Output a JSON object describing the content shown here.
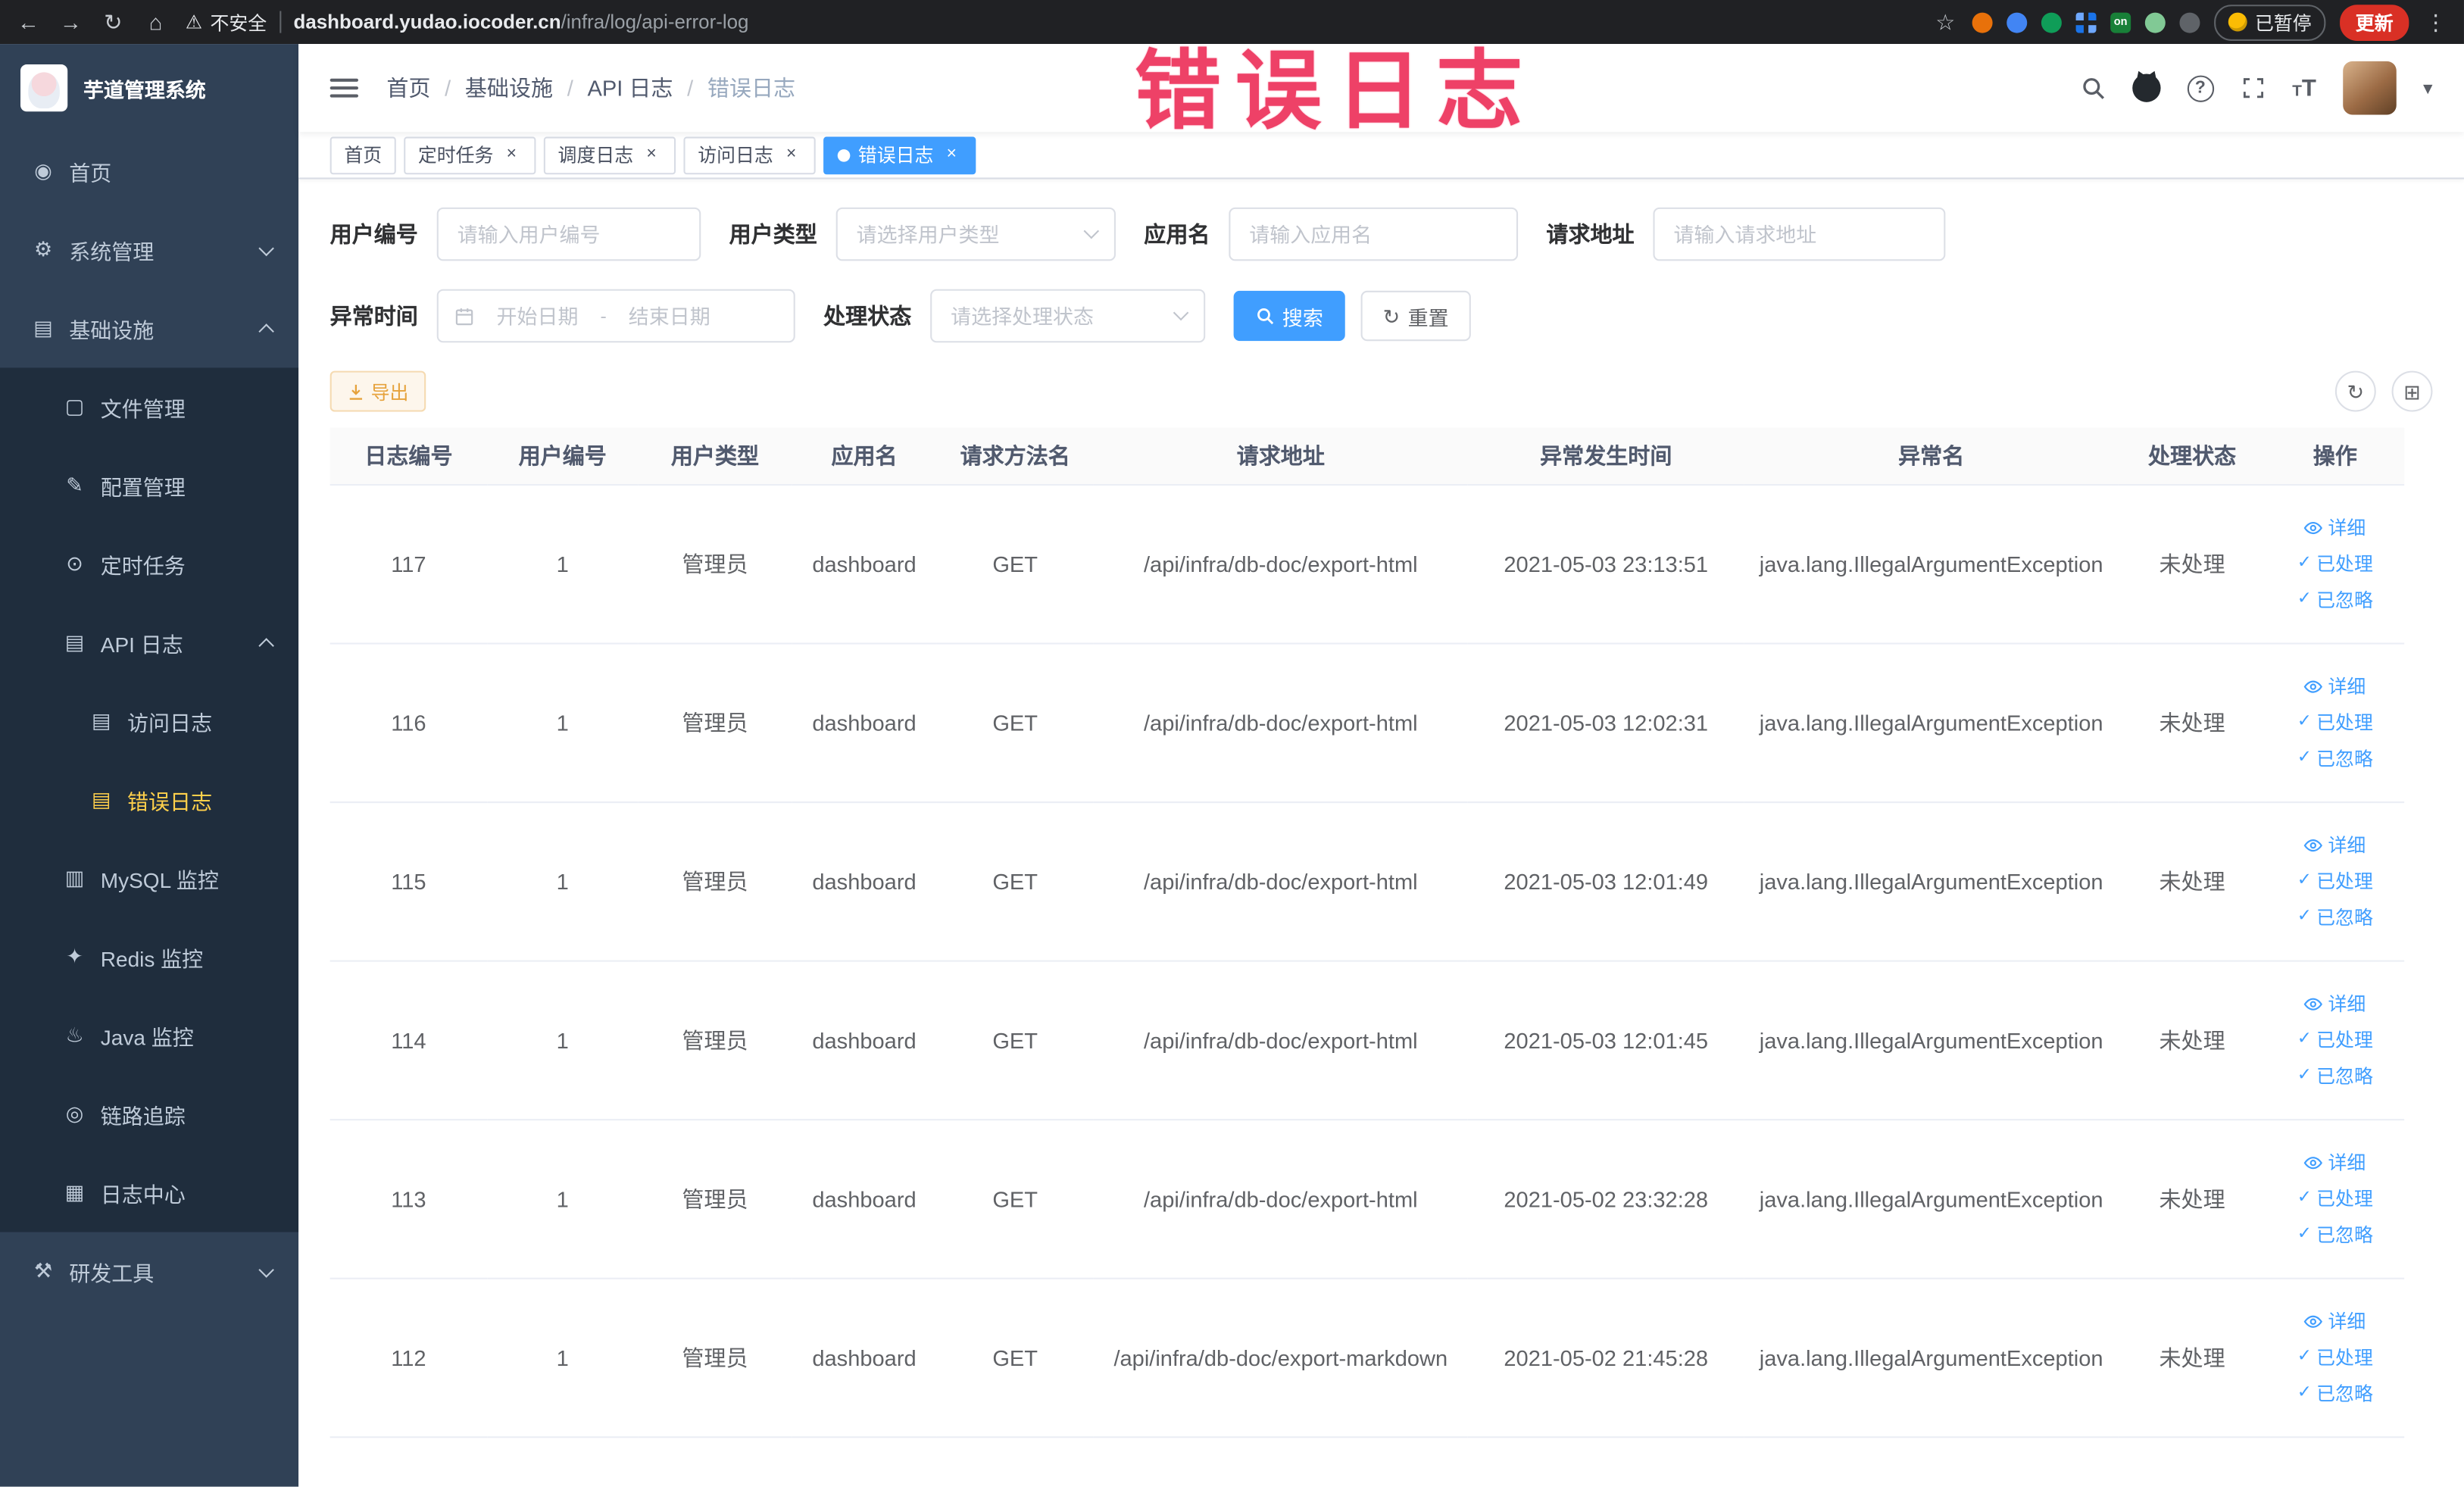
{
  "browser": {
    "security_label": "不安全",
    "url_host": "dashboard.yudao.iocoder.cn",
    "url_path": "/infra/log/api-error-log",
    "ext_on_label": "on",
    "paused_badge": "已暂停",
    "update_button": "更新"
  },
  "icons": {
    "back": "←",
    "forward": "→",
    "reload": "↻",
    "home": "⌂",
    "warning": "⚠",
    "star": "☆",
    "kebab": "⋮",
    "check": "✓",
    "caret_down": "▾",
    "sidebar_home": "◉",
    "sidebar_system": "⚙",
    "sidebar_infra": "▤",
    "sidebar_file": "▢",
    "sidebar_config": "✎",
    "sidebar_job": "⊙",
    "sidebar_api_log": "▤",
    "sidebar_access_log": "▤",
    "sidebar_error_log": "▤",
    "sidebar_mysql": "▥",
    "sidebar_redis": "✦",
    "sidebar_java": "♨",
    "sidebar_trace": "◎",
    "sidebar_log_center": "▦",
    "sidebar_dev_tools": "⚒",
    "refresh": "↻",
    "columns": "⊞"
  },
  "overlay": {
    "label": "错误日志"
  },
  "sidebar": {
    "app_title": "芋道管理系统",
    "items": {
      "home": "首页",
      "system": "系统管理",
      "infra": "基础设施",
      "file": "文件管理",
      "config": "配置管理",
      "job": "定时任务",
      "api_log": "API 日志",
      "access_log": "访问日志",
      "error_log": "错误日志",
      "mysql": "MySQL 监控",
      "redis": "Redis 监控",
      "java": "Java 监控",
      "trace": "链路追踪",
      "log_center": "日志中心",
      "dev_tools": "研发工具"
    }
  },
  "header": {
    "breadcrumb": [
      "首页",
      "基础设施",
      "API 日志",
      "错误日志"
    ]
  },
  "tabs": [
    {
      "label": "首页",
      "closable": false,
      "active": false
    },
    {
      "label": "定时任务",
      "closable": true,
      "active": false
    },
    {
      "label": "调度日志",
      "closable": true,
      "active": false
    },
    {
      "label": "访问日志",
      "closable": true,
      "active": false
    },
    {
      "label": "错误日志",
      "closable": true,
      "active": true
    }
  ],
  "filters": {
    "user_id": {
      "label": "用户编号",
      "placeholder": "请输入用户编号"
    },
    "user_type": {
      "label": "用户类型",
      "placeholder": "请选择用户类型"
    },
    "app_name": {
      "label": "应用名",
      "placeholder": "请输入应用名"
    },
    "request_url": {
      "label": "请求地址",
      "placeholder": "请输入请求地址"
    },
    "exception_time": {
      "label": "异常时间",
      "start_placeholder": "开始日期",
      "separator": "-",
      "end_placeholder": "结束日期"
    },
    "process_status": {
      "label": "处理状态",
      "placeholder": "请选择处理状态"
    },
    "search_button": "搜索",
    "reset_button": "重置"
  },
  "toolbar": {
    "export_button": "导出"
  },
  "table": {
    "columns": [
      "日志编号",
      "用户编号",
      "用户类型",
      "应用名",
      "请求方法名",
      "请求地址",
      "异常发生时间",
      "异常名",
      "处理状态",
      "操作"
    ],
    "row_actions": [
      "详细",
      "已处理",
      "已忽略"
    ],
    "rows": [
      {
        "id": "117",
        "user_id": "1",
        "user_type": "管理员",
        "app_name": "dashboard",
        "method": "GET",
        "url": "/api/infra/db-doc/export-html",
        "time": "2021-05-03 23:13:51",
        "exception": "java.lang.IllegalArgumentException",
        "status": "未处理"
      },
      {
        "id": "116",
        "user_id": "1",
        "user_type": "管理员",
        "app_name": "dashboard",
        "method": "GET",
        "url": "/api/infra/db-doc/export-html",
        "time": "2021-05-03 12:02:31",
        "exception": "java.lang.IllegalArgumentException",
        "status": "未处理"
      },
      {
        "id": "115",
        "user_id": "1",
        "user_type": "管理员",
        "app_name": "dashboard",
        "method": "GET",
        "url": "/api/infra/db-doc/export-html",
        "time": "2021-05-03 12:01:49",
        "exception": "java.lang.IllegalArgumentException",
        "status": "未处理"
      },
      {
        "id": "114",
        "user_id": "1",
        "user_type": "管理员",
        "app_name": "dashboard",
        "method": "GET",
        "url": "/api/infra/db-doc/export-html",
        "time": "2021-05-03 12:01:45",
        "exception": "java.lang.IllegalArgumentException",
        "status": "未处理"
      },
      {
        "id": "113",
        "user_id": "1",
        "user_type": "管理员",
        "app_name": "dashboard",
        "method": "GET",
        "url": "/api/infra/db-doc/export-html",
        "time": "2021-05-02 23:32:28",
        "exception": "java.lang.IllegalArgumentException",
        "status": "未处理"
      },
      {
        "id": "112",
        "user_id": "1",
        "user_type": "管理员",
        "app_name": "dashboard",
        "method": "GET",
        "url": "/api/infra/db-doc/export-markdown",
        "time": "2021-05-02 21:45:28",
        "exception": "java.lang.IllegalArgumentException",
        "status": "未处理"
      }
    ]
  }
}
